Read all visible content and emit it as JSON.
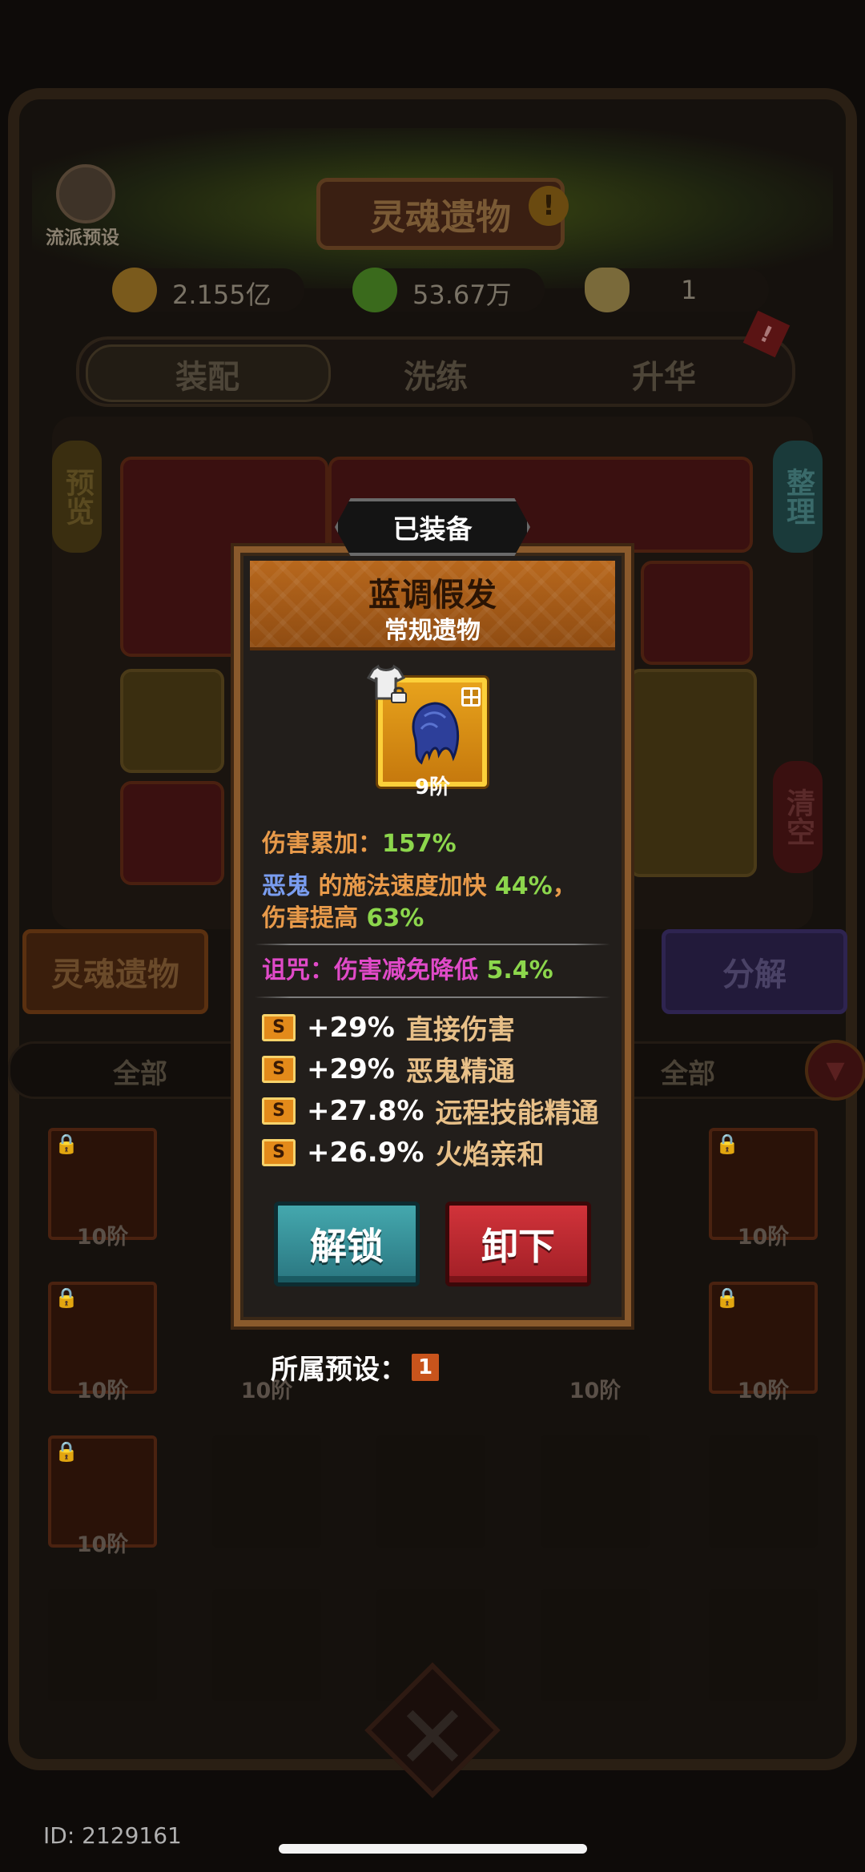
{
  "header": {
    "title": "灵魂遗物",
    "warn_icon": "exclamation-icon",
    "preset_button_label": "流派预设",
    "preset_icon": "book-icon"
  },
  "currencies": [
    {
      "icon": "coin-icon",
      "value": "2.155亿"
    },
    {
      "icon": "soul-spirit-icon",
      "value": "53.67万"
    },
    {
      "icon": "tooth-icon",
      "value": "1"
    }
  ],
  "tabs": [
    {
      "label": "装配",
      "active": true
    },
    {
      "label": "洗练",
      "active": false
    },
    {
      "label": "升华",
      "active": false
    }
  ],
  "equip_side": {
    "preview_label": "预览",
    "arrange_label": "整理",
    "clear_label": "清空"
  },
  "action_buttons": {
    "soul_relic_label": "灵魂遗物",
    "decompose_label": "分解"
  },
  "filters": {
    "left": "全部",
    "right": "全部"
  },
  "inventory": {
    "row1": [
      "10阶",
      "",
      "",
      "",
      "10阶"
    ],
    "row2": [
      "10阶",
      "10阶",
      "",
      "10阶",
      "10阶"
    ],
    "row3": [
      "10阶"
    ]
  },
  "popup": {
    "tag": "已装备",
    "item_name": "蓝调假发",
    "item_type": "常规遗物",
    "item_tier": "9阶",
    "stats": {
      "damage_stack_label": "伤害累加：",
      "damage_stack_value": "157%",
      "demon_name": "恶鬼",
      "cast_speed_text": " 的施法速度加快 ",
      "cast_speed_value": "44%",
      "comma": "，",
      "damage_up_text": "伤害提高 ",
      "damage_up_value": "63%",
      "curse_label": "诅咒：",
      "curse_text": "伤害减免降低 ",
      "curse_value": "5.4%"
    },
    "affixes": [
      {
        "grade": "S",
        "value": "+29%",
        "name": "直接伤害"
      },
      {
        "grade": "S",
        "value": "+29%",
        "name": "恶鬼精通"
      },
      {
        "grade": "S",
        "value": "+27.8%",
        "name": "远程技能精通"
      },
      {
        "grade": "S",
        "value": "+26.9%",
        "name": "火焰亲和"
      }
    ],
    "unlock_label": "解锁",
    "unequip_label": "卸下",
    "preset_label": "所属预设：",
    "preset_number": "1"
  },
  "footer": {
    "player_id": "ID: 2129161"
  },
  "colors": {
    "popup_border": "#8a5a2c",
    "name_banner": "#b8681d",
    "stat_green": "#8cd64c",
    "stat_orange": "#e89a4a",
    "curse_magenta": "#e04ac8",
    "unlock_teal": "#44a8ae",
    "unequip_red": "#d1333a"
  }
}
